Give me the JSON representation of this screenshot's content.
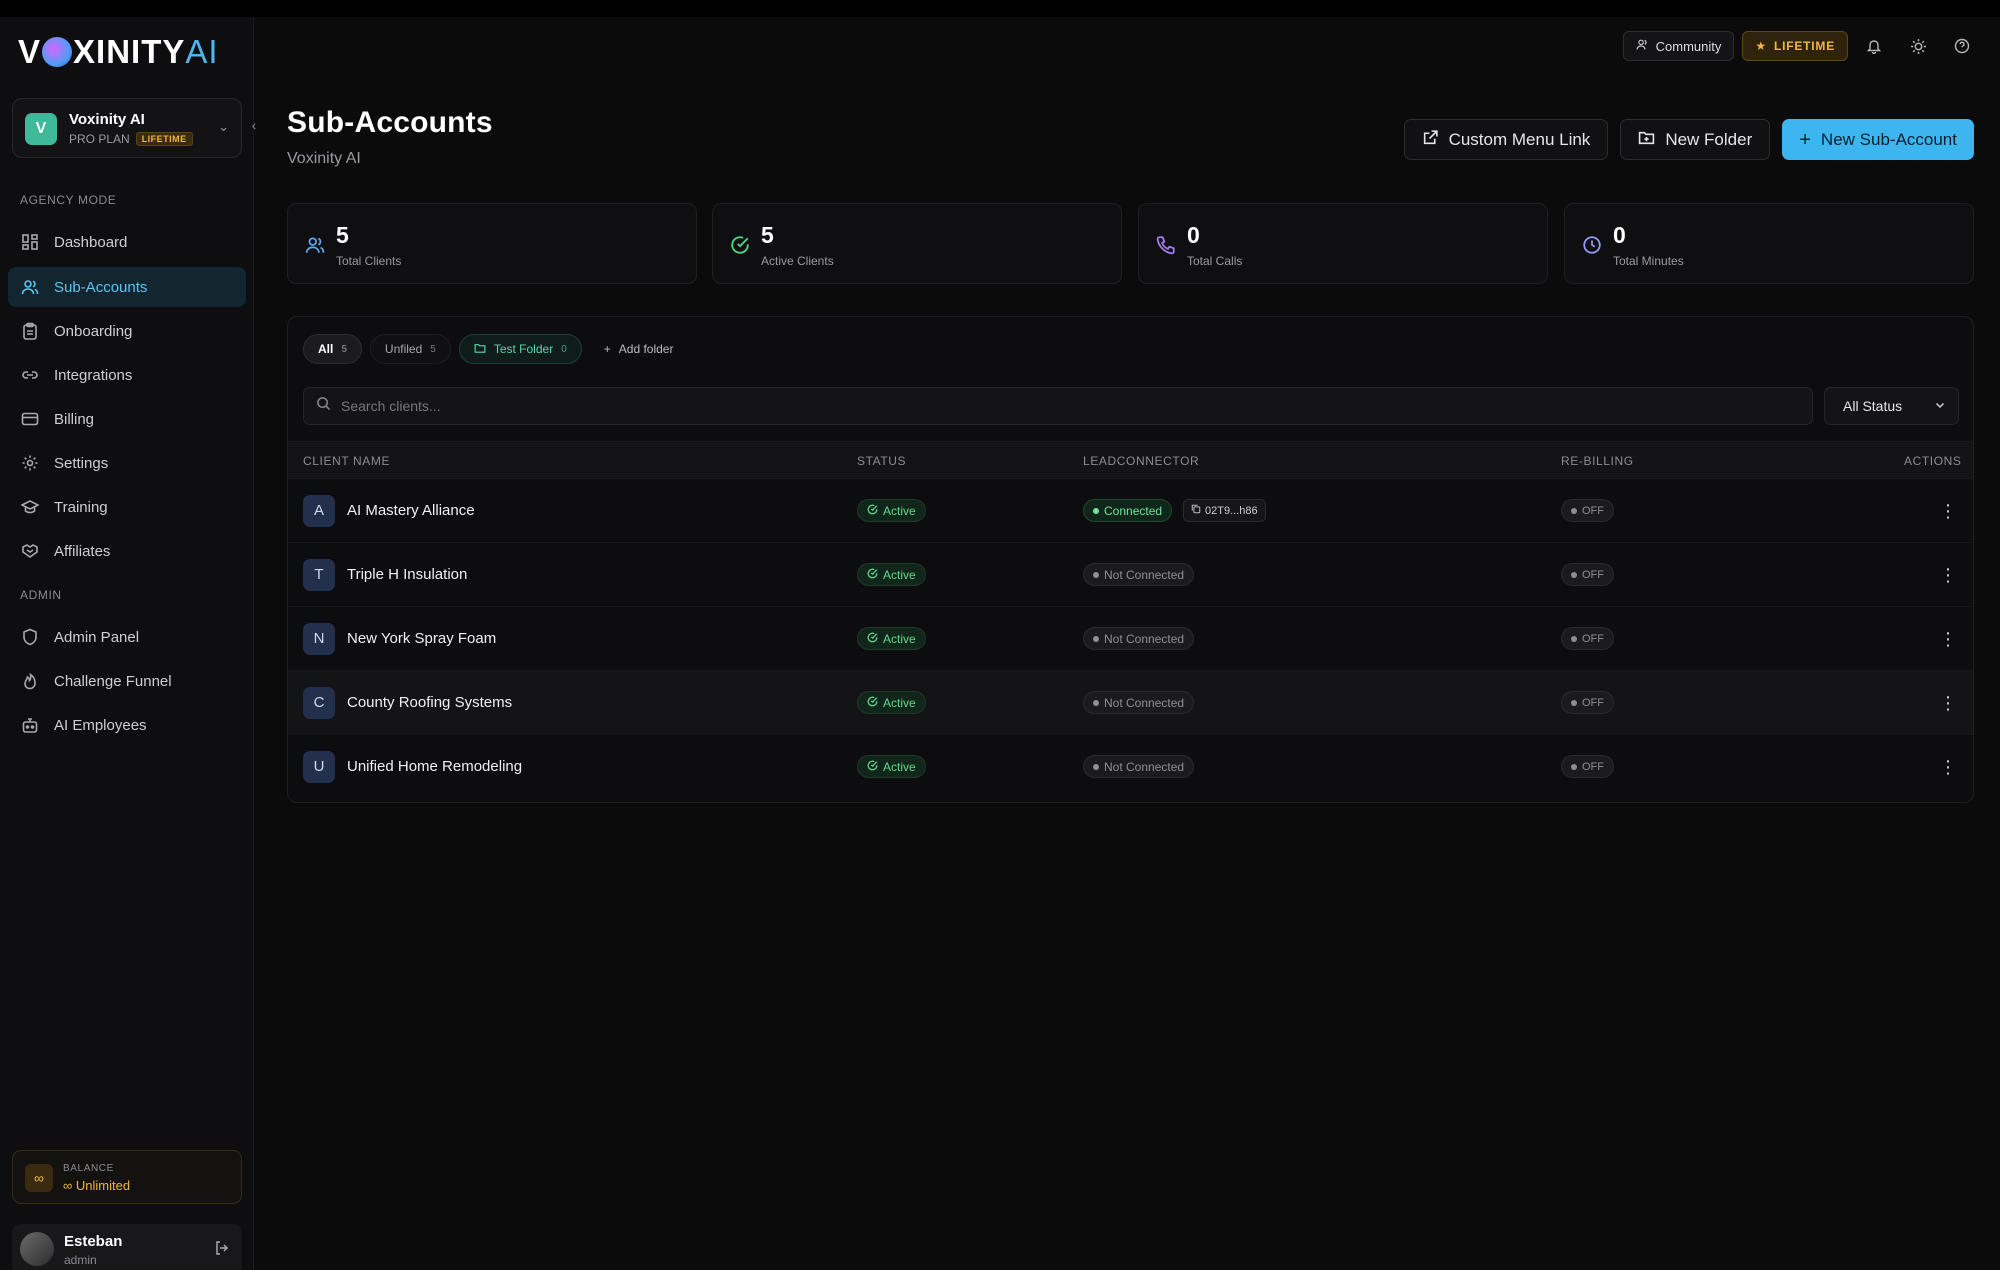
{
  "brand": {
    "logo_main": "V",
    "logo_rest": "XINITY",
    "logo_ai": "AI"
  },
  "workspace": {
    "avatar": "V",
    "name": "Voxinity AI",
    "plan": "PRO PLAN",
    "plan_badge": "LIFETIME"
  },
  "sidebar": {
    "agency_label": "AGENCY MODE",
    "agency_items": [
      {
        "label": "Dashboard",
        "icon": "grid-icon"
      },
      {
        "label": "Sub-Accounts",
        "icon": "users-icon"
      },
      {
        "label": "Onboarding",
        "icon": "clipboard-icon"
      },
      {
        "label": "Integrations",
        "icon": "link-icon"
      },
      {
        "label": "Billing",
        "icon": "card-icon"
      },
      {
        "label": "Settings",
        "icon": "gear-icon"
      },
      {
        "label": "Training",
        "icon": "graduation-cap-icon"
      },
      {
        "label": "Affiliates",
        "icon": "handshake-icon"
      }
    ],
    "admin_label": "ADMIN",
    "admin_items": [
      {
        "label": "Admin Panel",
        "icon": "shield-icon"
      },
      {
        "label": "Challenge Funnel",
        "icon": "flame-icon"
      },
      {
        "label": "AI Employees",
        "icon": "bot-icon"
      }
    ],
    "balance": {
      "label": "BALANCE",
      "value": "Unlimited"
    },
    "user": {
      "name": "Esteban",
      "role": "admin"
    }
  },
  "topbar": {
    "community_label": "Community",
    "lifetime_label": "LIFETIME"
  },
  "page": {
    "title": "Sub-Accounts",
    "subtitle": "Voxinity AI",
    "buttons": {
      "custom_menu_link": "Custom Menu Link",
      "new_folder": "New Folder",
      "new_sub_account": "New Sub-Account"
    }
  },
  "stats": [
    {
      "value": "5",
      "label": "Total Clients",
      "color": "#5aa8f0"
    },
    {
      "value": "5",
      "label": "Active Clients",
      "color": "#4fd07e"
    },
    {
      "value": "0",
      "label": "Total Calls",
      "color": "#a57cf0"
    },
    {
      "value": "0",
      "label": "Total Minutes",
      "color": "#8e9cf7"
    }
  ],
  "filters": {
    "tabs": [
      {
        "label": "All",
        "count": "5"
      },
      {
        "label": "Unfiled",
        "count": "5"
      },
      {
        "label": "Test Folder",
        "count": "0"
      }
    ],
    "add_folder": "Add folder",
    "search_placeholder": "Search clients...",
    "status_select": "All Status"
  },
  "table": {
    "headers": {
      "client": "CLIENT NAME",
      "status": "STATUS",
      "leadconnector": "LEADCONNECTOR",
      "rebilling": "RE-BILLING",
      "actions": "ACTIONS"
    },
    "rows": [
      {
        "initial": "A",
        "name": "AI Mastery Alliance",
        "status": "Active",
        "lc": "Connected",
        "lc_id": "02T9...h86",
        "rebilling": "OFF"
      },
      {
        "initial": "T",
        "name": "Triple H Insulation",
        "status": "Active",
        "lc": "Not Connected",
        "rebilling": "OFF"
      },
      {
        "initial": "N",
        "name": "New York Spray Foam",
        "status": "Active",
        "lc": "Not Connected",
        "rebilling": "OFF"
      },
      {
        "initial": "C",
        "name": "County Roofing Systems",
        "status": "Active",
        "lc": "Not Connected",
        "rebilling": "OFF"
      },
      {
        "initial": "U",
        "name": "Unified Home Remodeling",
        "status": "Active",
        "lc": "Not Connected",
        "rebilling": "OFF"
      }
    ]
  }
}
